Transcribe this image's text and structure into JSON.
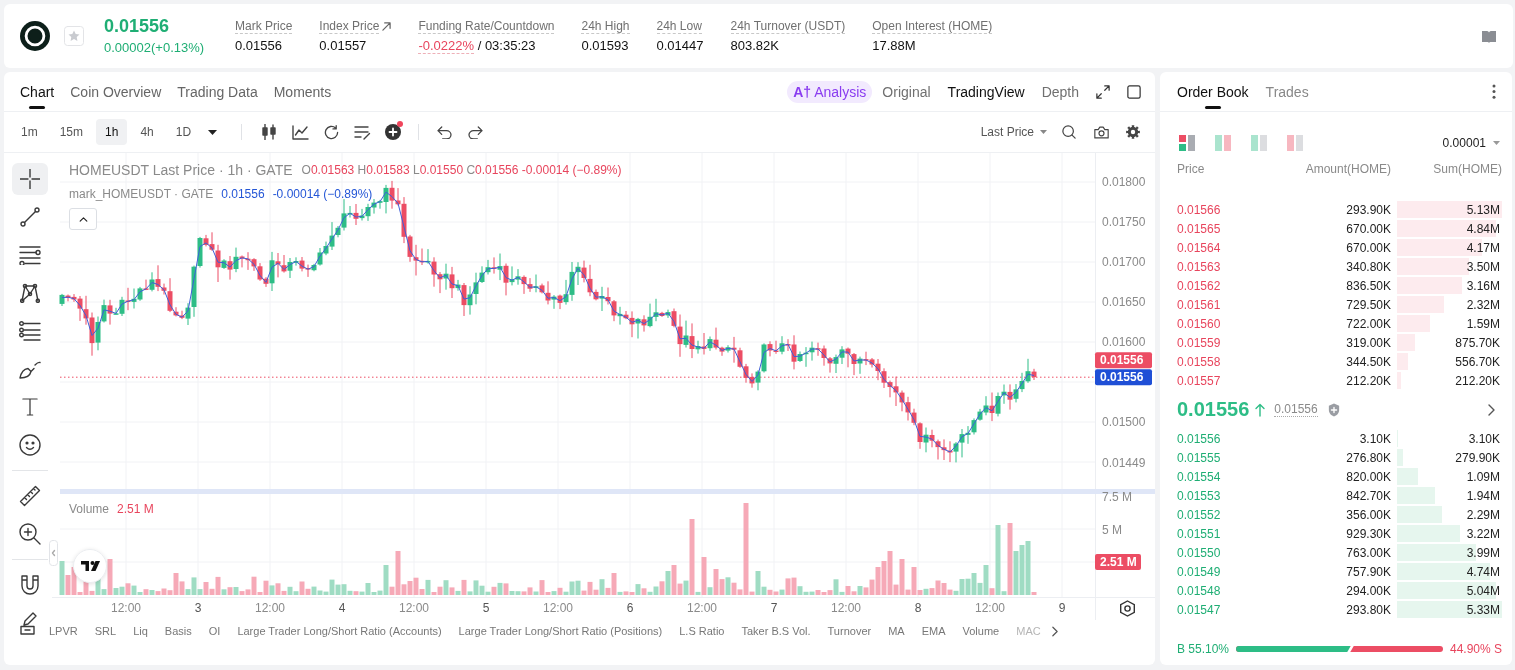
{
  "header": {
    "last_price": "0.01556",
    "change": "0.00002(+0.13%)",
    "stats": [
      {
        "kind": "plain",
        "label": "Mark Price",
        "value": "0.01556"
      },
      {
        "kind": "link",
        "label": "Index Price",
        "value": "0.01557"
      },
      {
        "kind": "funding",
        "label": "Funding Rate/Countdown",
        "rate": "-0.0222%",
        "countdown": "/ 03:35:23"
      },
      {
        "kind": "plain",
        "label": "24h High",
        "value": "0.01593"
      },
      {
        "kind": "plain",
        "label": "24h Low",
        "value": "0.01447"
      },
      {
        "kind": "plain",
        "label": "24h Turnover (USDT)",
        "value": "803.82K"
      },
      {
        "kind": "plain",
        "label": "Open Interest (HOME)",
        "value": "17.88M"
      }
    ]
  },
  "chart_panel": {
    "tabs": [
      {
        "label": "Chart",
        "selected": true
      },
      {
        "label": "Coin Overview",
        "selected": false
      },
      {
        "label": "Trading Data",
        "selected": false
      },
      {
        "label": "Moments",
        "selected": false
      }
    ],
    "views": [
      {
        "kind": "ai",
        "icon": "A†",
        "label": "Analysis",
        "selected": false
      },
      {
        "kind": "plain",
        "label": "Original",
        "selected": false
      },
      {
        "kind": "plain",
        "label": "TradingView",
        "selected": true
      },
      {
        "kind": "plain",
        "label": "Depth",
        "selected": false
      }
    ],
    "toolbar": {
      "intervals": [
        {
          "label": "1m",
          "selected": false
        },
        {
          "label": "15m",
          "selected": false
        },
        {
          "label": "1h",
          "selected": true
        },
        {
          "label": "4h",
          "selected": false
        },
        {
          "label": "1D",
          "selected": false
        }
      ],
      "indicator_alert": true,
      "price_source": "Last Price"
    },
    "tool_groups": [
      {
        "tools": [
          {
            "kind": "crosshair",
            "selected": true
          },
          {
            "kind": "trend_line",
            "selected": false
          },
          {
            "kind": "parallel_lines",
            "selected": false
          },
          {
            "kind": "pattern",
            "selected": false
          },
          {
            "kind": "levels",
            "selected": false
          },
          {
            "kind": "brush",
            "selected": false
          },
          {
            "kind": "text",
            "selected": false
          },
          {
            "kind": "emoji",
            "selected": false
          }
        ]
      },
      {
        "tools": [
          {
            "kind": "ruler",
            "selected": false
          },
          {
            "kind": "zoom",
            "selected": false
          }
        ]
      },
      {
        "tools": [
          {
            "kind": "magnet",
            "selected": false
          },
          {
            "kind": "pencil",
            "selected": false
          }
        ]
      }
    ],
    "legend": {
      "title": "HOMEUSDT Last Price · 1h · GATE",
      "ohlc": [
        {
          "key": "O",
          "value": "0.01563"
        },
        {
          "key": "H",
          "value": "0.01583"
        },
        {
          "key": "L",
          "value": "0.01550"
        },
        {
          "key": "C",
          "value": "0.01556"
        }
      ],
      "change": "-0.00014 (−0.89%)",
      "mark_title": "mark_HOMEUSDT · GATE",
      "mark_value": "0.01556",
      "mark_change": "-0.00014 (−0.89%)"
    },
    "price_axis": [
      "0.01800",
      "0.01750",
      "0.01700",
      "0.01650",
      "0.01600",
      "0.01500",
      "0.01449"
    ],
    "price_badges": [
      {
        "value": "0.01556",
        "color": "#ec4d64"
      },
      {
        "value": "0.01556",
        "color": "#1f4fd6"
      }
    ],
    "volume": {
      "label": "Volume",
      "value": "2.51 M",
      "axis": [
        "7.5 M",
        "5 M"
      ],
      "badge": "2.51 M"
    },
    "time_axis": [
      {
        "label": "12:00",
        "kind": "hour"
      },
      {
        "label": "3",
        "kind": "day"
      },
      {
        "label": "12:00",
        "kind": "hour"
      },
      {
        "label": "4",
        "kind": "day"
      },
      {
        "label": "12:00",
        "kind": "hour"
      },
      {
        "label": "5",
        "kind": "day"
      },
      {
        "label": "12:00",
        "kind": "hour"
      },
      {
        "label": "6",
        "kind": "day"
      },
      {
        "label": "12:00",
        "kind": "hour"
      },
      {
        "label": "7",
        "kind": "day"
      },
      {
        "label": "12:00",
        "kind": "hour"
      },
      {
        "label": "8",
        "kind": "day"
      },
      {
        "label": "12:00",
        "kind": "hour"
      },
      {
        "label": "9",
        "kind": "day"
      }
    ],
    "indicators": [
      "LPVR",
      "SRL",
      "Liq",
      "Basis",
      "OI",
      "Large Trader Long/Short Ratio (Accounts)",
      "Large Trader Long/Short Ratio (Positions)",
      "L.S Ratio",
      "Taker B.S Vol.",
      "Turnover",
      "MA",
      "EMA",
      "Volume",
      "MAC"
    ]
  },
  "order_book": {
    "tabs": [
      {
        "label": "Order Book",
        "selected": true
      },
      {
        "label": "Trades",
        "selected": false
      }
    ],
    "layouts": [
      {
        "kind": "both",
        "selected": true
      },
      {
        "kind": "split",
        "selected": false
      },
      {
        "kind": "bids",
        "selected": false
      },
      {
        "kind": "asks",
        "selected": false
      }
    ],
    "precision": "0.00001",
    "columns": [
      "Price",
      "Amount(HOME)",
      "Sum(HOME)"
    ],
    "asks": [
      {
        "price": "0.01566",
        "amount": "293.90K",
        "sum": "5.13M"
      },
      {
        "price": "0.01565",
        "amount": "670.00K",
        "sum": "4.84M"
      },
      {
        "price": "0.01564",
        "amount": "670.00K",
        "sum": "4.17M"
      },
      {
        "price": "0.01563",
        "amount": "340.80K",
        "sum": "3.50M"
      },
      {
        "price": "0.01562",
        "amount": "836.50K",
        "sum": "3.16M"
      },
      {
        "price": "0.01561",
        "amount": "729.50K",
        "sum": "2.32M"
      },
      {
        "price": "0.01560",
        "amount": "722.00K",
        "sum": "1.59M"
      },
      {
        "price": "0.01559",
        "amount": "319.00K",
        "sum": "875.70K"
      },
      {
        "price": "0.01558",
        "amount": "344.50K",
        "sum": "556.70K"
      },
      {
        "price": "0.01557",
        "amount": "212.20K",
        "sum": "212.20K"
      }
    ],
    "last_price": "0.01556",
    "rising": true,
    "mark_price": "0.01556",
    "bids": [
      {
        "price": "0.01556",
        "amount": "3.10K",
        "sum": "3.10K"
      },
      {
        "price": "0.01555",
        "amount": "276.80K",
        "sum": "279.90K"
      },
      {
        "price": "0.01554",
        "amount": "820.00K",
        "sum": "1.09M"
      },
      {
        "price": "0.01553",
        "amount": "842.70K",
        "sum": "1.94M"
      },
      {
        "price": "0.01552",
        "amount": "356.00K",
        "sum": "2.29M"
      },
      {
        "price": "0.01551",
        "amount": "929.30K",
        "sum": "3.22M"
      },
      {
        "price": "0.01550",
        "amount": "763.00K",
        "sum": "3.99M"
      },
      {
        "price": "0.01549",
        "amount": "757.90K",
        "sum": "4.74M"
      },
      {
        "price": "0.01548",
        "amount": "294.00K",
        "sum": "5.04M"
      },
      {
        "price": "0.01547",
        "amount": "293.80K",
        "sum": "5.33M"
      }
    ],
    "buy": {
      "label": "B 55.10%",
      "level": 0.551
    },
    "sell": {
      "label": "44.90% S"
    }
  }
}
